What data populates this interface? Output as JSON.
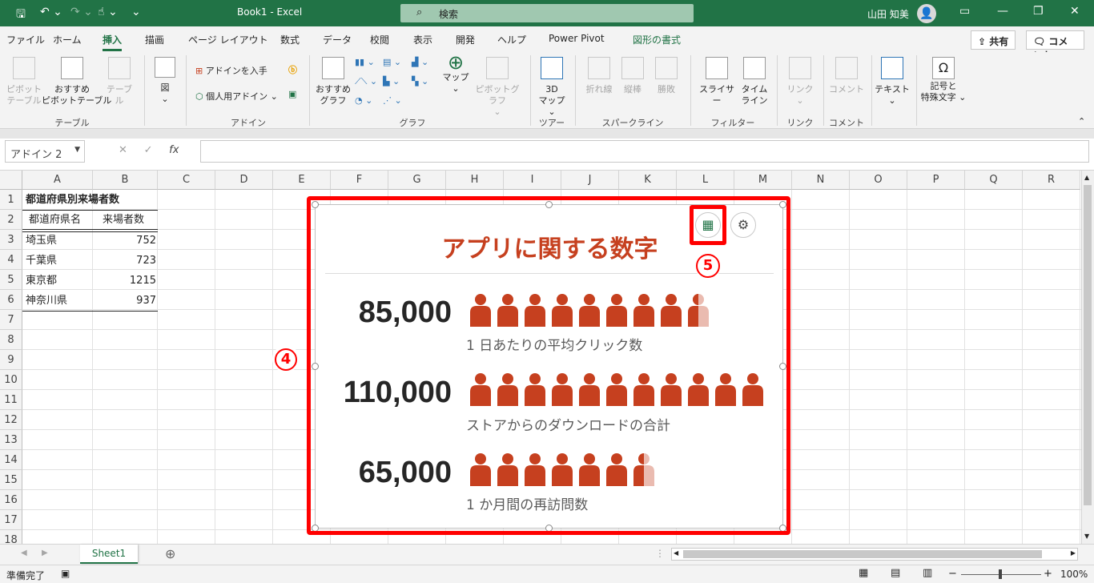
{
  "titlebar": {
    "title": "Book1  -  Excel",
    "search_placeholder": "検索",
    "user": "山田 知美"
  },
  "tabs": [
    "ファイル",
    "ホーム",
    "挿入",
    "描画",
    "ページ レイアウト",
    "数式",
    "データ",
    "校閲",
    "表示",
    "開発",
    "ヘルプ",
    "Power Pivot",
    "図形の書式"
  ],
  "share": {
    "share_label": "共有",
    "comment_label": "コメント"
  },
  "ribbon": {
    "pivot": "ピボット\nテーブル",
    "recommended_pivot": "おすすめ\nピボットテーブル",
    "table": "テーブル",
    "group_table": "テーブル",
    "figure": "図",
    "get_addin": "アドインを入手",
    "my_addin": "個人用アドイン",
    "group_addin": "アドイン",
    "recommended_chart": "おすすめ\nグラフ",
    "map": "マップ",
    "pivot_chart": "ピボットグラフ",
    "group_chart": "グラフ",
    "map3d": "3D\nマップ",
    "group_tour": "ツアー",
    "line": "折れ線",
    "column": "縦棒",
    "winloss": "勝敗",
    "group_sparkline": "スパークライン",
    "slicer": "スライサー",
    "timeline": "タイム\nライン",
    "group_filter": "フィルター",
    "link": "リンク",
    "group_link": "リンク",
    "comment": "コメント",
    "group_comment": "コメント",
    "text": "テキスト",
    "symbol": "記号と\n特殊文字"
  },
  "formula": {
    "namebox": "アドイン 2",
    "fx": "fx"
  },
  "columns": [
    "A",
    "B",
    "C",
    "D",
    "E",
    "F",
    "G",
    "H",
    "I",
    "J",
    "K",
    "L",
    "M",
    "N",
    "O",
    "P",
    "Q",
    "R"
  ],
  "rows": [
    "1",
    "2",
    "3",
    "4",
    "5",
    "6",
    "7",
    "8",
    "9",
    "10",
    "11",
    "12",
    "13",
    "14",
    "15",
    "16",
    "17",
    "18"
  ],
  "sheet": {
    "a1": "都道府県別来場者数",
    "header_a": "都道府県名",
    "header_b": "来場者数",
    "data": [
      {
        "name": "埼玉県",
        "value": "752"
      },
      {
        "name": "千葉県",
        "value": "723"
      },
      {
        "name": "東京都",
        "value": "1215"
      },
      {
        "name": "神奈川県",
        "value": "937"
      }
    ]
  },
  "infographic": {
    "title": "アプリに関する数字",
    "stats": [
      {
        "number": "85,000",
        "label": "1 日あたりの平均クリック数",
        "full": 8,
        "partial": 0.5
      },
      {
        "number": "110,000",
        "label": "ストアからのダウンロードの合計",
        "full": 11,
        "partial": 0
      },
      {
        "number": "65,000",
        "label": "1 か月間の再訪問数",
        "full": 6,
        "partial": 0.5
      }
    ],
    "person_color": "#c6401f"
  },
  "markers": {
    "four": "4",
    "five": "5"
  },
  "sheettab": "Sheet1",
  "status": {
    "ready": "準備完了",
    "zoom": "100%"
  }
}
